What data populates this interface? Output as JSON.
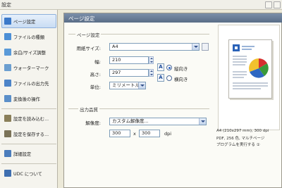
{
  "window": {
    "title": "設定"
  },
  "sidebar": {
    "items": [
      {
        "label": "ページ設定",
        "color": "#3b79c9"
      },
      {
        "label": "ファイルの種類",
        "color": "#4c8fd6"
      },
      {
        "label": "余白/サイズ調整",
        "color": "#5a9ad8"
      },
      {
        "label": "ウォーターマーク",
        "color": "#6c9fd0"
      },
      {
        "label": "ファイルの出力先",
        "color": "#4d84c8"
      },
      {
        "label": "変換後の操作",
        "color": "#5b8fc9"
      },
      {
        "label": "設定を読み込む...",
        "color": "#8a7f5a"
      },
      {
        "label": "設定を保存する...",
        "color": "#7b7358"
      },
      {
        "label": "詳細設定",
        "color": "#4b7dbc"
      },
      {
        "label": "UDC について",
        "color": "#3f6fb0"
      }
    ]
  },
  "main": {
    "header": "ページ設定",
    "page_group": "ページ設定",
    "paper_size_label": "用紙サイズ:",
    "paper_size_value": "A4",
    "width_label": "幅:",
    "width_value": "210",
    "height_label": "高さ:",
    "height_value": "297",
    "unit_label": "単位:",
    "unit_value": "ミリメートル",
    "portrait_label": "縦向き",
    "landscape_label": "横向き",
    "orientation_selected": "portrait",
    "quality_group": "出力品質",
    "resolution_label": "解像度:",
    "resolution_value": "カスタム解像度...",
    "dpi_x": "300",
    "dpi_sep": "x",
    "dpi_y": "300",
    "dpi_unit": "dpi"
  },
  "preview": {
    "info_line1": "A4 (210x297 mm), 300 dpi",
    "info_line2": "PDF, 256 色, マルチページ",
    "info_line3": "プログラムを実行する ①"
  }
}
